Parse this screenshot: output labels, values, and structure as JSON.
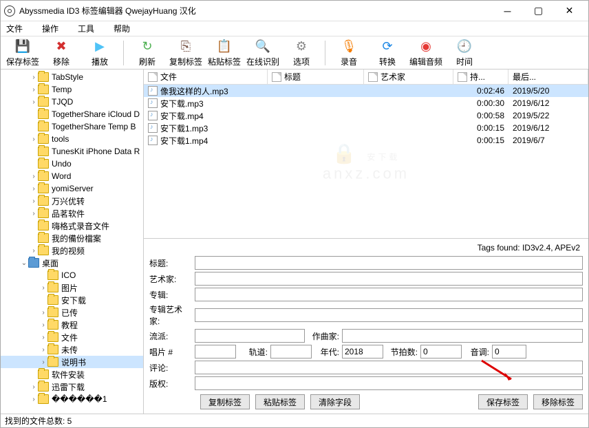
{
  "title": "Abyssmedia ID3 标签编辑器 QwejayHuang 汉化",
  "menu": [
    "文件",
    "操作",
    "工具",
    "帮助"
  ],
  "toolbar": {
    "save": "保存标签",
    "delete": "移除",
    "play": "播放",
    "refresh": "刷新",
    "copy": "复制标签",
    "paste": "粘贴标签",
    "online": "在线识别",
    "options": "选项",
    "record": "录音",
    "convert": "转换",
    "editaudio": "编辑音频",
    "time": "时间"
  },
  "tree": [
    {
      "d": 3,
      "t": ">",
      "n": "TabStyle"
    },
    {
      "d": 3,
      "t": ">",
      "n": "Temp"
    },
    {
      "d": 3,
      "t": ">",
      "n": "TJQD"
    },
    {
      "d": 3,
      "t": "",
      "n": "TogetherShare iCloud D"
    },
    {
      "d": 3,
      "t": "",
      "n": "TogetherShare Temp B"
    },
    {
      "d": 3,
      "t": ">",
      "n": "tools"
    },
    {
      "d": 3,
      "t": "",
      "n": "TunesKit iPhone Data R"
    },
    {
      "d": 3,
      "t": "",
      "n": "Undo"
    },
    {
      "d": 3,
      "t": ">",
      "n": "Word"
    },
    {
      "d": 3,
      "t": ">",
      "n": "yomiServer"
    },
    {
      "d": 3,
      "t": ">",
      "n": "万兴优转"
    },
    {
      "d": 3,
      "t": ">",
      "n": "品茗软件"
    },
    {
      "d": 3,
      "t": "",
      "n": "嗨格式录音文件"
    },
    {
      "d": 3,
      "t": "",
      "n": "我的備份檔案"
    },
    {
      "d": 3,
      "t": ">",
      "n": "我的视频"
    },
    {
      "d": 2,
      "t": "v",
      "n": "桌面",
      "blue": true
    },
    {
      "d": 4,
      "t": "",
      "n": "ICO"
    },
    {
      "d": 4,
      "t": ">",
      "n": "图片"
    },
    {
      "d": 4,
      "t": "",
      "n": "安下载"
    },
    {
      "d": 4,
      "t": ">",
      "n": "已传"
    },
    {
      "d": 4,
      "t": ">",
      "n": "教程"
    },
    {
      "d": 4,
      "t": ">",
      "n": "文件"
    },
    {
      "d": 4,
      "t": ">",
      "n": "未传"
    },
    {
      "d": 4,
      "t": ">",
      "n": "说明书",
      "sel": true
    },
    {
      "d": 3,
      "t": "",
      "n": "软件安装"
    },
    {
      "d": 3,
      "t": ">",
      "n": "迅雷下载"
    },
    {
      "d": 3,
      "t": ">",
      "n": "������1"
    }
  ],
  "columns": {
    "file": "文件",
    "title": "标题",
    "artist": "艺术家",
    "dur": "持...",
    "date": "最后..."
  },
  "files": [
    {
      "n": "像我这样的人.mp3",
      "dur": "0:02:46",
      "date": "2019/5/20",
      "sel": true
    },
    {
      "n": "安下载.mp3",
      "dur": "0:00:30",
      "date": "2019/6/12"
    },
    {
      "n": "安下载.mp4",
      "dur": "0:00:58",
      "date": "2019/5/22"
    },
    {
      "n": "安下载1.mp3",
      "dur": "0:00:15",
      "date": "2019/6/12"
    },
    {
      "n": "安下载1.mp4",
      "dur": "0:00:15",
      "date": "2019/6/7"
    }
  ],
  "watermark": {
    "l1": "安下载",
    "l2": "anxz.com"
  },
  "tagsfound": "Tags found: ID3v2.4, APEv2",
  "form": {
    "title": "标题:",
    "artist": "艺术家:",
    "album": "专辑:",
    "albumartist": "专辑艺术家:",
    "genre": "流派:",
    "composer": "作曲家:",
    "disc": "唱片 #",
    "track": "轨道:",
    "year": "年代:",
    "bpm": "节拍数:",
    "key": "音调:",
    "comment": "评论:",
    "copyright": "版权:",
    "year_val": "2018",
    "bpm_val": "0",
    "key_val": "0"
  },
  "buttons": {
    "copy": "复制标签",
    "paste": "粘贴标签",
    "clear": "清除字段",
    "save": "保存标签",
    "remove": "移除标签"
  },
  "status": "找到的文件总数: 5"
}
